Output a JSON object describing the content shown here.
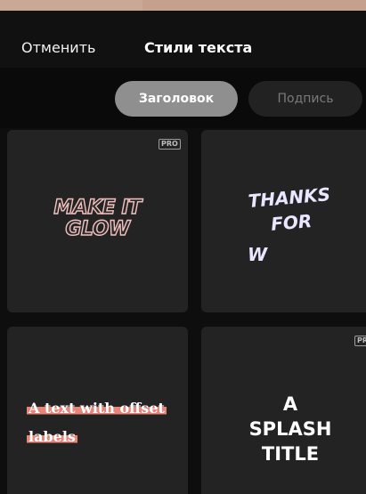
{
  "header": {
    "cancel_label": "Отменить",
    "title": "Стили текста"
  },
  "tabs": [
    {
      "label": "Заголовок",
      "selected": true
    },
    {
      "label": "Подпись",
      "selected": false
    }
  ],
  "styles": [
    {
      "preview_line1": "MAKE IT",
      "preview_line2": "GLOW",
      "badge": "PRO"
    },
    {
      "preview_line1": "THANKS",
      "preview_line2": "FOR",
      "preview_line3": "W"
    },
    {
      "preview_line1": "A text with offset",
      "preview_line2": "labels"
    },
    {
      "preview_line1": "A",
      "preview_line2": "SPLASH",
      "preview_line3": "TITLE",
      "badge": "PRO"
    }
  ],
  "colors": {
    "background": "#0e0e0e",
    "card": "#232323",
    "active_pill": "#8f8f8f",
    "inactive_pill": "#222222",
    "glow_outline": "#f3c1bf",
    "offset_label": "#e88478",
    "thanks_text": "#eae6ff"
  }
}
